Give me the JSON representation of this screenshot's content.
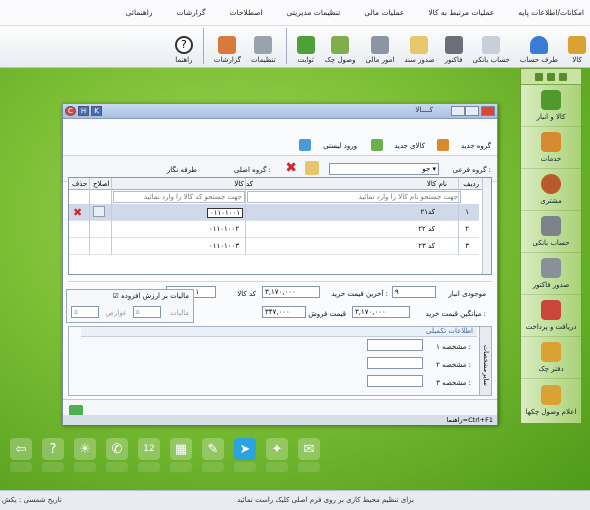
{
  "menu": [
    "امکانات/اطلاعات پایه",
    "عملیات مرتبط به کالا",
    "عملیات مالی",
    "تنظیمات مدیریتی",
    "اصطلاحات",
    "گزارشات",
    "راهنمائی"
  ],
  "toolbar": [
    {
      "label": "کالا",
      "icon": "box-icon",
      "color": "#d9a233"
    },
    {
      "label": "طرف حساب",
      "icon": "person-icon",
      "color": "#3a7bd5"
    },
    {
      "label": "حساب بانکی",
      "icon": "pen-icon",
      "color": "#c8cfd8"
    },
    {
      "label": "فاکتور",
      "icon": "calculator-icon",
      "color": "#6a6f78"
    },
    {
      "label": "صدور سند",
      "icon": "document-pen-icon",
      "color": "#e6c76e"
    },
    {
      "label": "امور مالی",
      "icon": "tools-icon",
      "color": "#8c95a3"
    },
    {
      "label": "وصول چک",
      "icon": "money-icon",
      "color": "#7fae4a"
    },
    {
      "label": "ثوابت",
      "icon": "cube-icon",
      "color": "#4fa038"
    },
    {
      "label": "تنظیمات",
      "icon": "wrench-icon",
      "color": "#9aa2ad"
    },
    {
      "label": "گزارشات",
      "icon": "chart-icon",
      "color": "#d77a3a"
    },
    {
      "label": "راهنما",
      "icon": "help-icon",
      "color": "#ffffff"
    }
  ],
  "right_panel": [
    {
      "label": "کالا و انبار",
      "icon": "warehouse-icon",
      "color": "#4f9a2a"
    },
    {
      "label": "خدمات",
      "icon": "services-icon",
      "color": "#d88a30"
    },
    {
      "label": "مشتری",
      "icon": "customer-icon",
      "color": "#b85a2a"
    },
    {
      "label": "حساب بانکی",
      "icon": "bank-icon",
      "color": "#7d838c"
    },
    {
      "label": "صدور فاکتور",
      "icon": "invoice-icon",
      "color": "#8a9099"
    },
    {
      "label": "دریافت و پرداخت",
      "icon": "payment-icon",
      "color": "#c9463a"
    },
    {
      "label": "دفتر چک",
      "icon": "cheque-book-icon",
      "color": "#d9a233"
    },
    {
      "label": "اعلام وصول چکها",
      "icon": "cheque-notify-icon",
      "color": "#d9a233"
    }
  ],
  "window": {
    "title": "کــــالا",
    "tabs_small": [
      "C",
      "H",
      "K"
    ],
    "group_label": "گروه جدید",
    "new_item": "کالای جدید",
    "import_list": "ورود لیستی",
    "sub_group_label": "گروه فرعی :",
    "sub_group_value": "جو",
    "main_group_label": "گروه اصلی :",
    "party_label": "طرفه نگار",
    "grid": {
      "headers": [
        "ردیف",
        "نام کالا",
        "کد کالا",
        "اصلاح",
        "حذف"
      ],
      "search_name": "جهت جستجو نام کالا را وارد نمائید",
      "search_code": "جهت جستجو کد کالا را وارد نمائید",
      "rows": [
        {
          "num": "۱",
          "name": "کد۲۱",
          "code": "۰۱۱۰۱۰۰۱"
        },
        {
          "num": "۲",
          "name": "کد ۲۲",
          "code": "۰۱۱۰۱۰۰۲"
        },
        {
          "num": "۳",
          "name": "کد ۲۳",
          "code": "۰۱۱۰۱۰۰۳"
        }
      ]
    },
    "stock_label": "موجودی انبار",
    "stock_value": "۹",
    "last_buy_label": "آخرین قیمت خرید :",
    "last_buy_value": "۳,۱۷۰,۰۰۰",
    "code_label": "کد کالا",
    "code_value": "۰۱۱۰۱۰۰۱",
    "avg_buy_label": "میانگین قیمت خرید :",
    "avg_buy_value": "۳,۱۷۰,۰۰۰",
    "sell_label": "قیمت فروش",
    "sell_value": "۳۴۷,۰۰۰",
    "tax_title": "مالیات بر ارزش افزوده",
    "tax_label": "مالیات",
    "duty_label": "عوارض",
    "tax_value": "۵",
    "duty_value": "۵",
    "tab_header": "اطلاعات تکمیلی",
    "side_tabs": [
      "مشخصات",
      "سایر"
    ],
    "spec1": "مشخصه ۱ :",
    "spec2": "مشخصه ۲ :",
    "spec3": "مشخصه ۳ :",
    "status": "راهنما=Ctrl+F1"
  },
  "statusbar": {
    "left": "تاریخ شمسی : یکش",
    "right": "برای تنظیم محیط کاری بر روی فرم اصلی کلیک راست نمائید"
  },
  "dock": [
    "exit-icon",
    "help-icon",
    "weather-icon",
    "phone-icon",
    "calendar-icon",
    "calculator-icon",
    "notepad-icon",
    "telegram-icon",
    "settings-icon",
    "dictionary-icon"
  ]
}
